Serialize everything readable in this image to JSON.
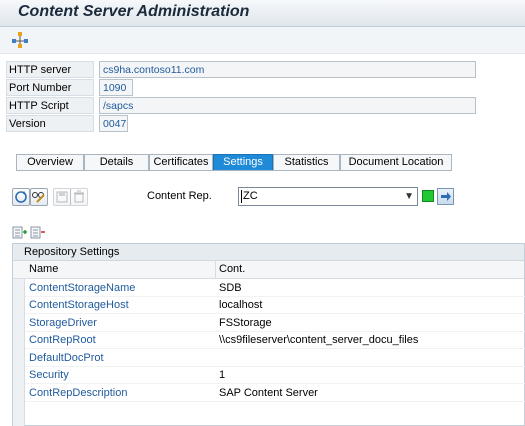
{
  "window": {
    "title": "Content Server Administration"
  },
  "toolbar": {
    "icon": "layout-tree-icon"
  },
  "fields": [
    {
      "label": "HTTP server",
      "value": "cs9ha.contoso11.com"
    },
    {
      "label": "Port Number",
      "value": "1090"
    },
    {
      "label": "HTTP Script",
      "value": "/sapcs"
    },
    {
      "label": "Version",
      "value": "0047"
    }
  ],
  "tabs": [
    {
      "label": "Overview"
    },
    {
      "label": "Details"
    },
    {
      "label": "Certificates"
    },
    {
      "label": "Settings",
      "active": true
    },
    {
      "label": "Statistics"
    },
    {
      "label": "Document Location"
    }
  ],
  "settings": {
    "content_rep_label": "Content Rep.",
    "content_rep_value": "ZC",
    "status_color": "#22c832"
  },
  "repository": {
    "title": "Repository Settings",
    "columns": [
      "Name",
      "Cont."
    ],
    "rows": [
      {
        "name": "ContentStorageName",
        "value": "SDB"
      },
      {
        "name": "ContentStorageHost",
        "value": "localhost"
      },
      {
        "name": "StorageDriver",
        "value": "FSStorage"
      },
      {
        "name": "ContRepRoot",
        "value": "\\\\cs9fileserver\\content_server_docu_files"
      },
      {
        "name": "DefaultDocProt",
        "value": ""
      },
      {
        "name": "Security",
        "value": "1"
      },
      {
        "name": "ContRepDescription",
        "value": "SAP Content Server"
      }
    ]
  }
}
